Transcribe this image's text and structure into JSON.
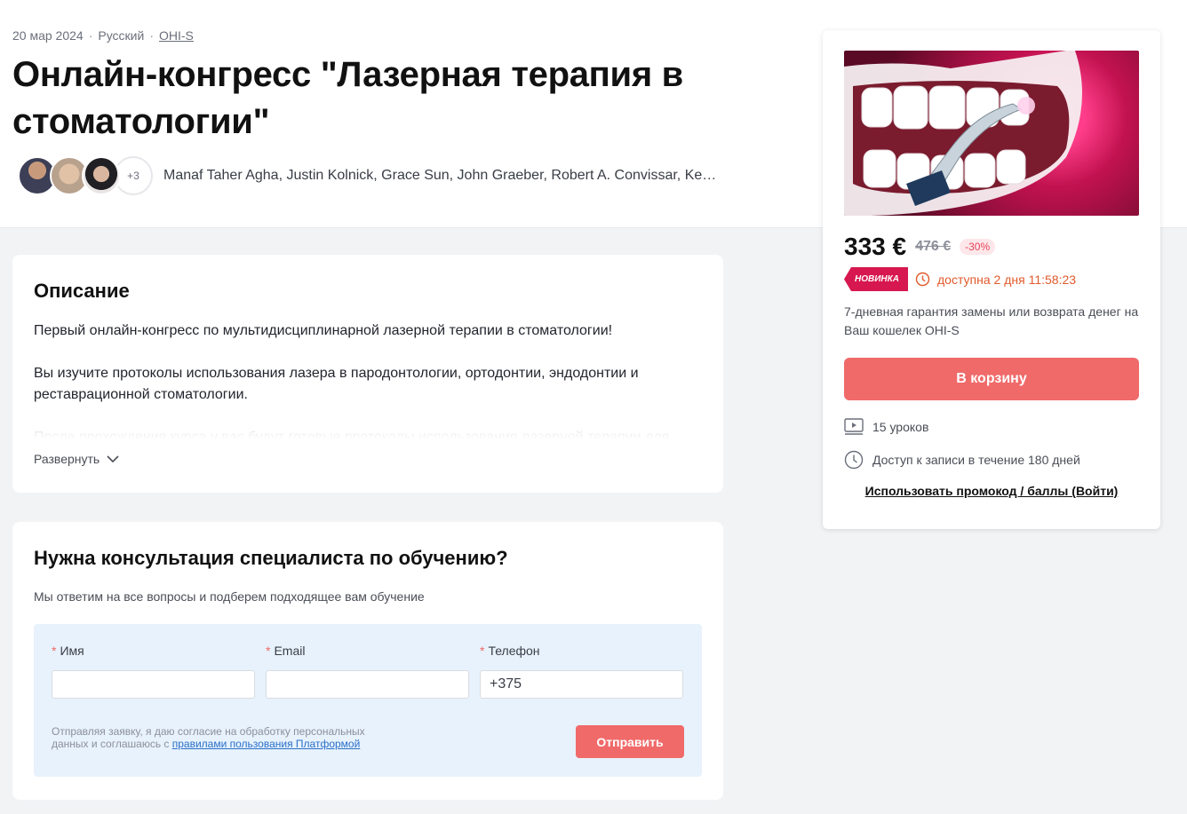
{
  "header": {
    "date": "20 мар 2024",
    "language": "Русский",
    "provider_link": "OHI-S",
    "title": "Онлайн-конгресс \"Лазерная терапия в стоматологии\"",
    "authors_more": "+3",
    "authors_names": "Manaf Taher Agha, Justin Kolnick, Grace Sun, John Graeber, Robert A. Convissar, Kenn…"
  },
  "description": {
    "heading": "Описание",
    "paragraph_1": "Первый онлайн-конгресс по мультидисциплинарной лазерной терапии в стоматологии!",
    "paragraph_2": "Вы изучите протоколы использования лазера в пародонтологии, ортодонтии, эндодонтии и реставрационной стоматологии.",
    "paragraph_3_faded": "После прохождения курса у вас будут готовые протоколы использования лазерной терапии для",
    "expand_label": "Развернуть"
  },
  "consult": {
    "heading": "Нужна консультация специалиста по обучению?",
    "subtitle": "Мы ответим на все вопросы и подберем подходящее вам обучение",
    "required_mark": "*",
    "name_label": "Имя",
    "email_label": "Email",
    "phone_label": "Телефон",
    "name_value": "",
    "email_value": "",
    "phone_value": "+375",
    "consent_text": "Отправляя заявку, я даю согласие на обработку персональных данных и соглашаюсь с ",
    "consent_link": "правилами пользования Платформой",
    "submit_label": "Отправить"
  },
  "purchase": {
    "price": "333 €",
    "old_price": "476 €",
    "discount": "-30%",
    "new_badge": "НОВИНКА",
    "timer_text": "доступна 2 дня 11:58:23",
    "guarantee": "7-дневная гарантия замены или возврата денег на Ваш кошелек OHI-S",
    "cart_label": "В корзину",
    "lessons": "15 уроков",
    "access": "Доступ к записи в течение 180 дней",
    "promo_link": "Использовать промокод / баллы (Войти)"
  },
  "colors": {
    "accent": "#f06a6a",
    "badge": "#d7174f",
    "timer": "#e05a2b",
    "link": "#2a6fc9"
  },
  "icons": [
    "chevron-down-icon",
    "clock-icon",
    "video-lesson-icon",
    "access-clock-icon"
  ]
}
